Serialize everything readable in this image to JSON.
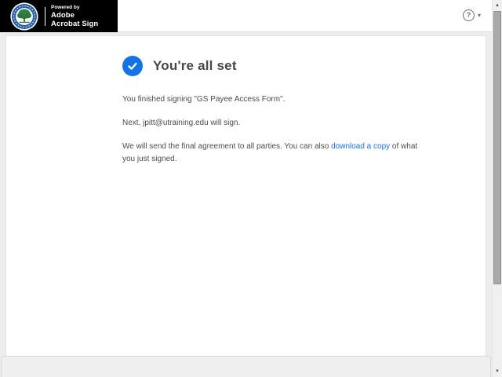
{
  "header": {
    "logo_name": "university-seal",
    "powered_by": "Powered by",
    "brand_line1": "Adobe",
    "brand_line2": "Acrobat Sign",
    "help_glyph": "?"
  },
  "content": {
    "title": "You're all set",
    "finished_text": "You finished signing \"GS Payee Access Form\".",
    "next_text": "Next, jpitt@utraining.edu will sign.",
    "final_before_link": "We will send the final agreement to all parties. You can also ",
    "download_link_label": "download a copy",
    "final_after_link": " of what you just signed."
  },
  "icons": {
    "scroll_up": "▲",
    "scroll_down": "▼",
    "caret_down": "▾"
  },
  "colors": {
    "accent_blue": "#1473E6",
    "link_blue": "#1473E6",
    "header_badge_background": "#000000"
  }
}
